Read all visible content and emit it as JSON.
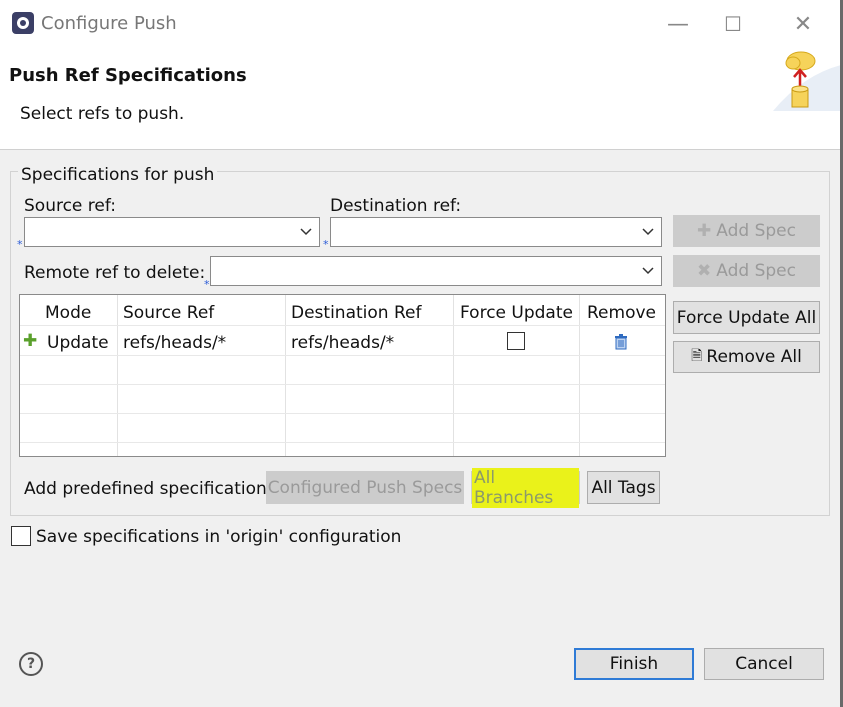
{
  "window": {
    "title": "Configure Push",
    "minimize_label": "—",
    "maximize_label": "☐",
    "close_label": "✕"
  },
  "header": {
    "title": "Push Ref Specifications",
    "subtitle": "Select refs to push."
  },
  "group": {
    "label": "Specifications for push",
    "source_ref_label": "Source ref:",
    "source_ref_value": "",
    "destination_ref_label": "Destination ref:",
    "destination_ref_value": "",
    "remote_delete_label": "Remote ref to delete:",
    "remote_delete_value": "",
    "required_marker": "*"
  },
  "buttons": {
    "add_spec": "Add Spec",
    "add_delete_spec": "Add Spec",
    "force_update_all": "Force Update All",
    "remove_all": "Remove All",
    "configured_push_specs": "Configured Push Specs",
    "all_branches": "All Branches",
    "all_tags": "All Tags",
    "finish": "Finish",
    "cancel": "Cancel"
  },
  "table": {
    "columns": [
      "Mode",
      "Source Ref",
      "Destination Ref",
      "Force Update",
      "Remove"
    ],
    "rows": [
      {
        "mode": "Update",
        "source": "refs/heads/*",
        "destination": "refs/heads/*",
        "force_update": false
      }
    ]
  },
  "predefined_label": "Add predefined specification",
  "save_spec": {
    "label": "Save specifications in 'origin' configuration",
    "checked": false
  },
  "help_label": "?",
  "colors": {
    "highlight": "#eaf21a",
    "primary_border": "#2f7bd6",
    "add_icon": "#5aa02c"
  }
}
